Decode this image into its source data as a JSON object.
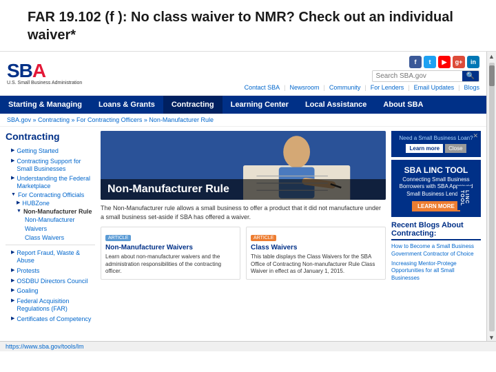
{
  "title": {
    "line1": "FAR 19.102 (f ):  No class waiver to NMR?  Check out an individual",
    "line2": "waiver*"
  },
  "browser": {
    "address": "https://www.sba.gov/tools/lm",
    "scroll_up": "▲",
    "scroll_down": "▼"
  },
  "sba": {
    "logo_text": "SBA",
    "logo_sub": "U.S. Small Business Administration",
    "search_placeholder": "Search SBA.gov",
    "social_links": [
      "f",
      "t",
      "▶",
      "g+"
    ],
    "nav_links": [
      "Contact SBA",
      "Newsroom",
      "Community",
      "For Lenders",
      "Email Updates",
      "Blogs"
    ],
    "nav_items": [
      "Starting & Managing",
      "Loans & Grants",
      "Contracting",
      "Learning Center",
      "Local Assistance",
      "About SBA"
    ],
    "breadcrumb": "SBA.gov » Contracting » For Contracting Officers » Non-Manufacturer Rule"
  },
  "sidebar": {
    "title": "Contracting",
    "items": [
      {
        "label": "Getting Started",
        "active": false
      },
      {
        "label": "Contracting Support for Small Businesses",
        "active": false
      },
      {
        "label": "Understanding the Federal Marketplace",
        "active": false
      },
      {
        "label": "For Contracting Officials",
        "active": true
      },
      {
        "label": "HUBZone",
        "sub": true
      },
      {
        "label": "Non-Manufacturer Rule",
        "sub": true,
        "current": true
      },
      {
        "label": "Non-Manufacturer Waivers",
        "child": true
      },
      {
        "label": "Class Waivers",
        "child": true
      },
      {
        "label": "Report Fraud, Waste & Abuse",
        "active": false
      },
      {
        "label": "Protests",
        "active": false
      },
      {
        "label": "OSDBU Directors Council",
        "active": false
      },
      {
        "label": "Goaling",
        "active": false
      },
      {
        "label": "Federal Acquisition Regulations (FAR)",
        "active": false
      },
      {
        "label": "Certificates of Competency",
        "active": false
      }
    ]
  },
  "hero": {
    "title": "Non-Manufacturer Rule"
  },
  "article": {
    "text": "The Non-Manufacturer rule allows a small business to offer a product that it did not manufacture under a small business set-aside if SBA has offered a waiver."
  },
  "cards": [
    {
      "badge": "ARTICLE",
      "title": "Non-Manufacturer Waivers",
      "text": "Learn about non-manufacturer waivers and the administration responsibilities of the contracting officer."
    },
    {
      "badge": "ARTICLE",
      "badge_color": "orange",
      "title": "Class Waivers",
      "text": "This table displays the Class Waivers for the SBA Office of Contracting Non-manufacturer Rule Class Waiver in effect as of January 1, 2015."
    }
  ],
  "loan_popup": {
    "title": "Need a Small Business Loan?",
    "subtitle": "Need a Small Business Loan?",
    "btn_learn": "Learn more",
    "btn_close": "Close"
  },
  "linc": {
    "title": "SBA LINC TOOL",
    "sub1": "Connecting Small Business",
    "sub2": "Borrowers with SBA Approved",
    "sub3": "Small Business Lenders",
    "learn_btn": "LEARN MORE",
    "side_tab": "LINC\nTOOL"
  },
  "blogs": {
    "title": "Recent Blogs About Contracting:",
    "items": [
      "How to Become a Small Business Government Contractor of Choice",
      "Increasing Mentor-Protege Opportunities for all Small Businesses"
    ]
  },
  "footer": {
    "link": "https://www.sba.gov/tools/lm"
  }
}
